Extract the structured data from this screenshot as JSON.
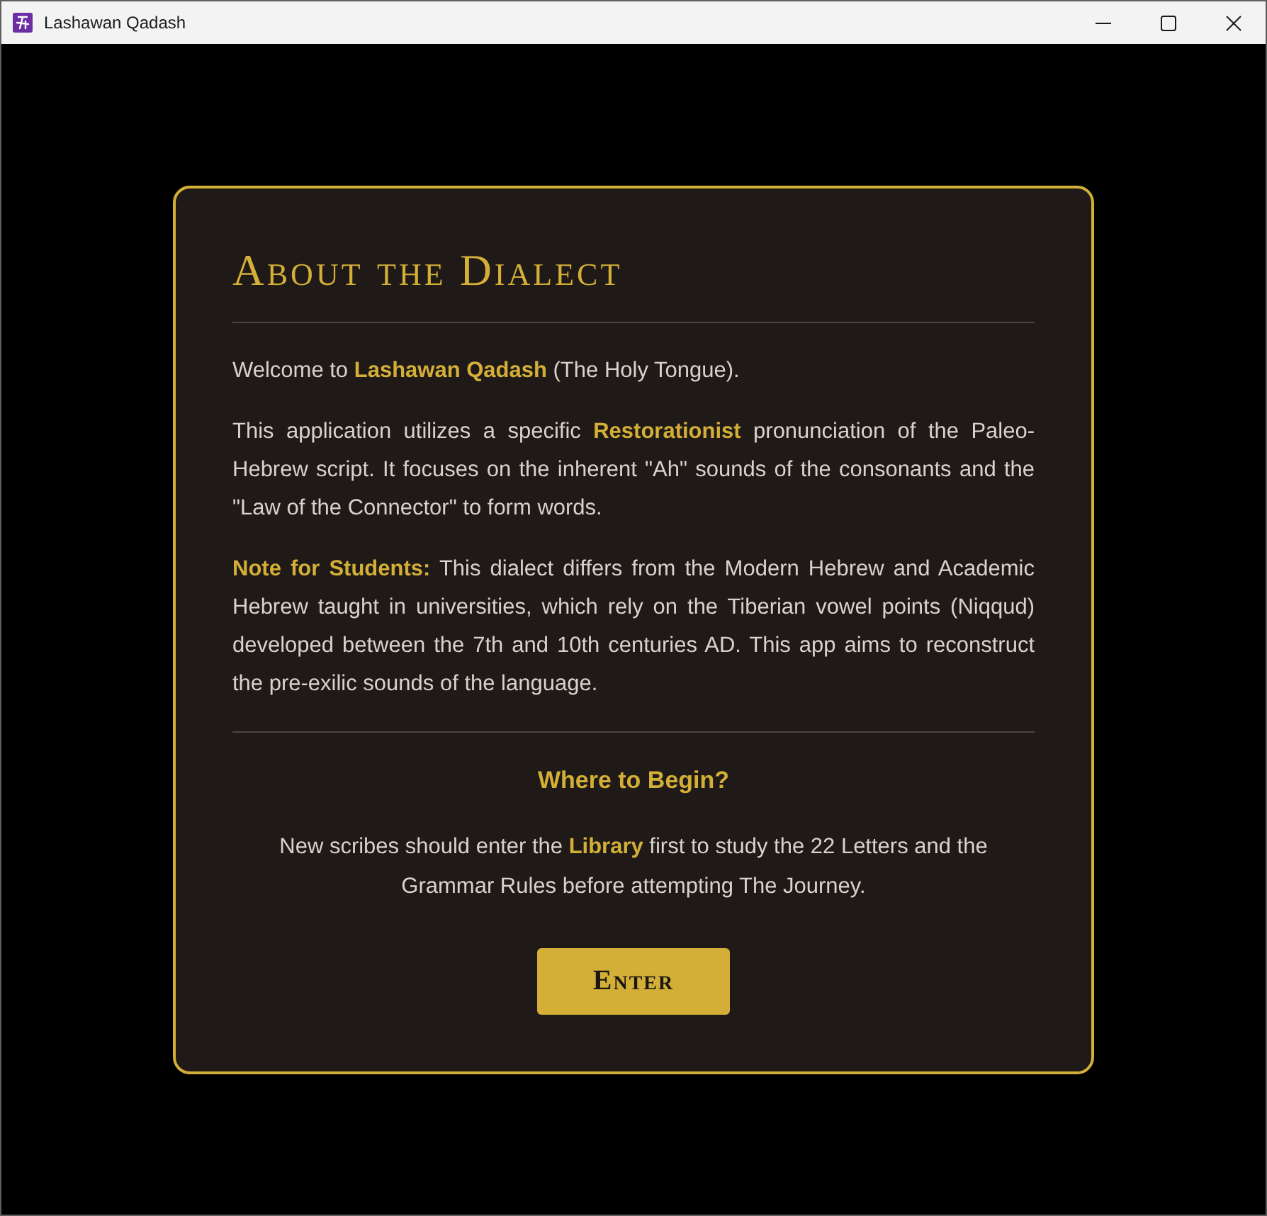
{
  "window": {
    "title": "Lashawan Qadash"
  },
  "dialog": {
    "title": "About the Dialect",
    "paragraphs": [
      "Welcome to **Lashawan Qadash** (The Holy Tongue).",
      "This application utilizes a specific **Restorationist** pronunciation of the Paleo-Hebrew script. It focuses on the inherent \"Ah\" sounds of the consonants and the \"Law of the Connector\" to form words.",
      "**Note for Students:** This dialect differs from the Modern Hebrew and Academic Hebrew taught in universities, which rely on the Tiberian vowel points (Niqqud) developed between the 7th and 10th centuries AD. This app aims to reconstruct the pre-exilic sounds of the language."
    ],
    "section_title": "Where to Begin?",
    "section_text": "New scribes should enter the **Library** first to study the 22 Letters and the Grammar Rules before attempting The Journey.",
    "button": "Enter"
  }
}
